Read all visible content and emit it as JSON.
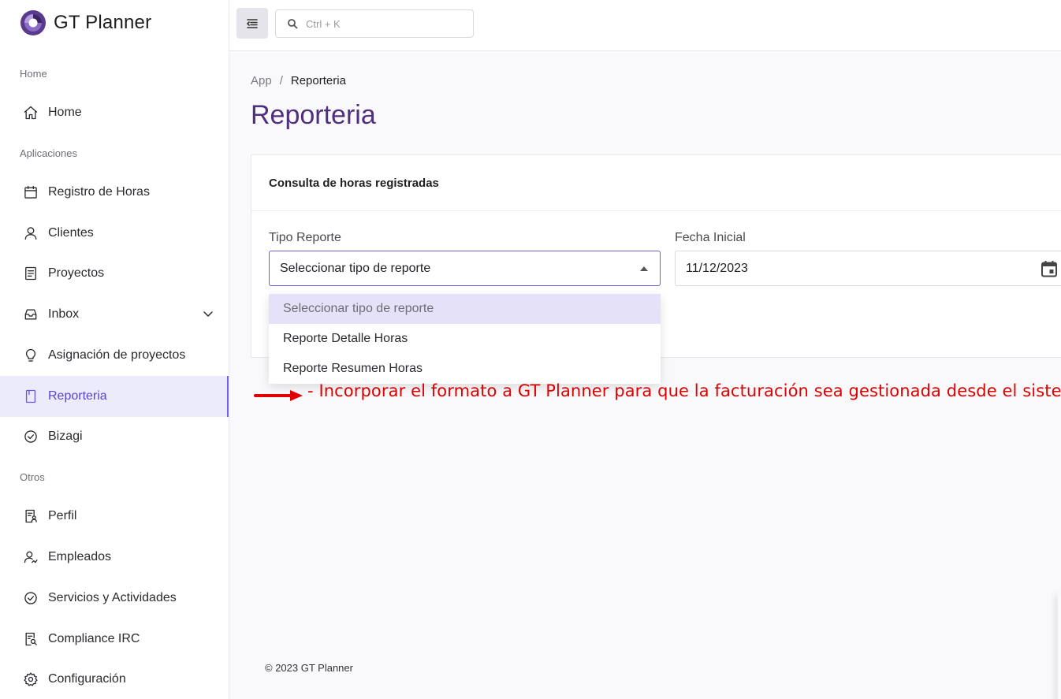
{
  "app": {
    "name": "GT Planner",
    "accent": "#6a55e3",
    "title_color": "#4f2f7f"
  },
  "sidebar": {
    "sections": {
      "home": "Home",
      "apps": "Aplicaciones",
      "others": "Otros"
    },
    "items": [
      {
        "label": "Home",
        "icon": "home-icon"
      },
      {
        "label": "Registro de Horas",
        "icon": "calendar-icon"
      },
      {
        "label": "Clientes",
        "icon": "user-icon"
      },
      {
        "label": "Proyectos",
        "icon": "document-icon"
      },
      {
        "label": "Inbox",
        "icon": "inbox-icon"
      },
      {
        "label": "Asignación de proyectos",
        "icon": "lightbulb-icon"
      },
      {
        "label": "Reporteria",
        "icon": "bookmark-icon"
      },
      {
        "label": "Bizagi",
        "icon": "check-circle-icon"
      },
      {
        "label": "Perfil",
        "icon": "profile-icon"
      },
      {
        "label": "Empleados",
        "icon": "users-icon"
      },
      {
        "label": "Servicios y Actividades",
        "icon": "check-circle-icon"
      },
      {
        "label": "Compliance IRC",
        "icon": "search-document-icon"
      },
      {
        "label": "Configuración",
        "icon": "gear-icon"
      }
    ],
    "active": "Reporteria"
  },
  "topbar": {
    "search_placeholder": "Ctrl + K"
  },
  "breadcrumb": {
    "root": "App",
    "sep": "/",
    "current": "Reporteria"
  },
  "page": {
    "title": "Reporteria"
  },
  "card": {
    "title": "Consulta de horas registradas",
    "tipo_label": "Tipo Reporte",
    "tipo_value": "Seleccionar tipo de reporte",
    "fecha_label": "Fecha Inicial",
    "fecha_value": "11/12/2023"
  },
  "dropdown": {
    "options": [
      "Seleccionar tipo de reporte",
      "Reporte Detalle Horas",
      "Reporte Resumen Horas"
    ]
  },
  "annotation": {
    "text": "- Incorporar el formato a GT Planner para que la facturación sea gestionada desde el sistema.",
    "color": "#e00000"
  },
  "footer": {
    "text": "© 2023 GT Planner"
  }
}
